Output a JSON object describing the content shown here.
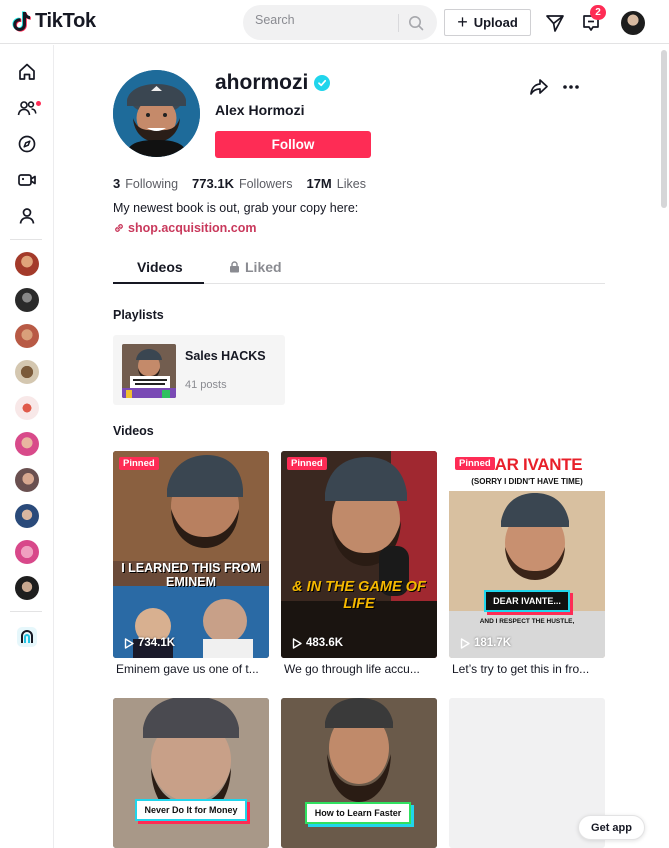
{
  "app": {
    "name": "TikTok"
  },
  "header": {
    "search_placeholder": "Search",
    "upload_label": "Upload",
    "inbox_badge": "2"
  },
  "sidebar": {
    "items": [
      {
        "name": "home-icon"
      },
      {
        "name": "following-icon"
      },
      {
        "name": "explore-icon"
      },
      {
        "name": "live-icon"
      },
      {
        "name": "profile-icon"
      }
    ],
    "following_avatars": 10
  },
  "profile": {
    "username": "ahormozi",
    "nickname": "Alex Hormozi",
    "follow_label": "Follow",
    "following_count": "3",
    "following_label": "Following",
    "followers_count": "773.1K",
    "followers_label": "Followers",
    "likes_count": "17M",
    "likes_label": "Likes",
    "bio": "My newest book is out, grab your copy here:",
    "link": "shop.acquisition.com"
  },
  "tabs": {
    "videos_label": "Videos",
    "liked_label": "Liked"
  },
  "playlists": {
    "title": "Playlists",
    "items": [
      {
        "name": "Sales HACKS",
        "count": "41 posts"
      }
    ]
  },
  "videos": {
    "title": "Videos",
    "pinned_label": "Pinned",
    "items": [
      {
        "views": "734.1K",
        "caption": "Eminem gave us one of t...",
        "overlay": "I LEARNED THIS FROM EMINEM"
      },
      {
        "views": "483.6K",
        "caption": "We go through life accu...",
        "overlay": "& IN THE GAME OF LIFE"
      },
      {
        "views": "181.7K",
        "caption": "Let’s try to get this in fro...",
        "overlay_top": "DEAR IVANTE",
        "overlay_sub": "(SORRY I DIDN'T HAVE TIME)",
        "overlay_box": "DEAR IVANTE...",
        "overlay_small": "AND I RESPECT THE HUSTLE,"
      },
      {
        "overlay_box": "Never Do It for Money"
      },
      {
        "overlay_box": "How to Learn Faster"
      }
    ]
  },
  "get_app_label": "Get app",
  "colors": {
    "accent": "#fe2c55",
    "verified": "#20d5ec",
    "link": "#c9395c"
  }
}
